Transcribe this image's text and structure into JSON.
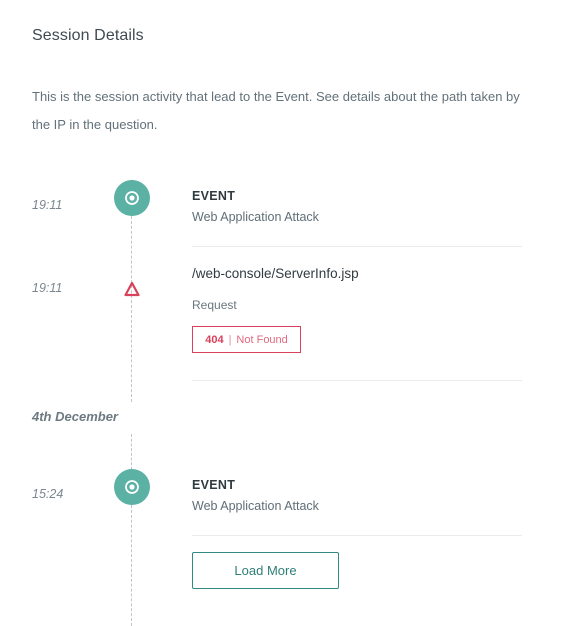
{
  "section": {
    "title": "Session Details",
    "description": "This is the session activity that lead to the Event. See details about the path taken by the IP in the question."
  },
  "timeline": {
    "items": [
      {
        "time": "19:11",
        "type": "event",
        "icon": "target-icon",
        "title": "EVENT",
        "subtitle": "Web Application Attack"
      },
      {
        "time": "19:11",
        "type": "request",
        "icon": "warning-triangle-icon",
        "path": "/web-console/ServerInfo.jsp",
        "label": "Request",
        "status_code": "404",
        "status_separator": "|",
        "status_text": "Not Found"
      },
      {
        "date": "4th December"
      },
      {
        "time": "15:24",
        "type": "event",
        "icon": "target-icon",
        "title": "EVENT",
        "subtitle": "Web Application Attack"
      }
    ],
    "load_more_label": "Load More"
  },
  "colors": {
    "event_dot": "#5bb1a4",
    "warning": "#d9415c",
    "button_border": "#2e8a83"
  }
}
